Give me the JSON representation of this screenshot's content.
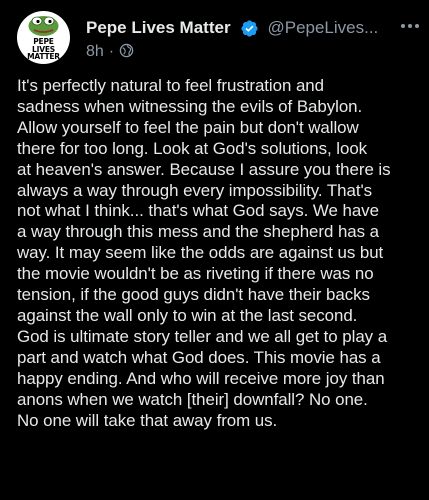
{
  "tweet": {
    "avatar": {
      "lines": [
        "PEPE",
        "LIVES",
        "MATTER"
      ],
      "icon": "pepe-frog-avatar"
    },
    "author": {
      "display_name": "Pepe Lives Matter",
      "handle": "@PepeLives...",
      "verified": true
    },
    "timestamp": "8h",
    "separator": "·",
    "audience_icon": "globe-icon",
    "more_icon": "ellipsis-icon",
    "body": "It's perfectly natural to feel frustration and\nsadness when witnessing the evils of Babylon.\nAllow yourself to feel the pain but don't wallow\nthere for too long. Look at God's solutions, look\nat heaven's answer. Because I assure you there is\nalways a way through every impossibility. That's\nnot what I think... that's what God says. We have\na way through this mess and the shepherd has a\nway. It may seem like the odds are against us but\nthe movie wouldn't be as riveting if there was no\ntension, if the good guys didn't have their backs\nagainst the wall only to win at the last second.\nGod is ultimate story teller and we all get to play a\npart and watch what God does. This movie has a\nhappy ending. And who will receive more joy than\nanons when we watch [their] downfall? No one.\nNo one will take that away from us."
  },
  "colors": {
    "background": "#000000",
    "text_primary": "#e7e9ea",
    "text_secondary": "#8b98a5",
    "verified_badge": "#1d9bf0",
    "avatar_green": "#5b9a3c"
  }
}
